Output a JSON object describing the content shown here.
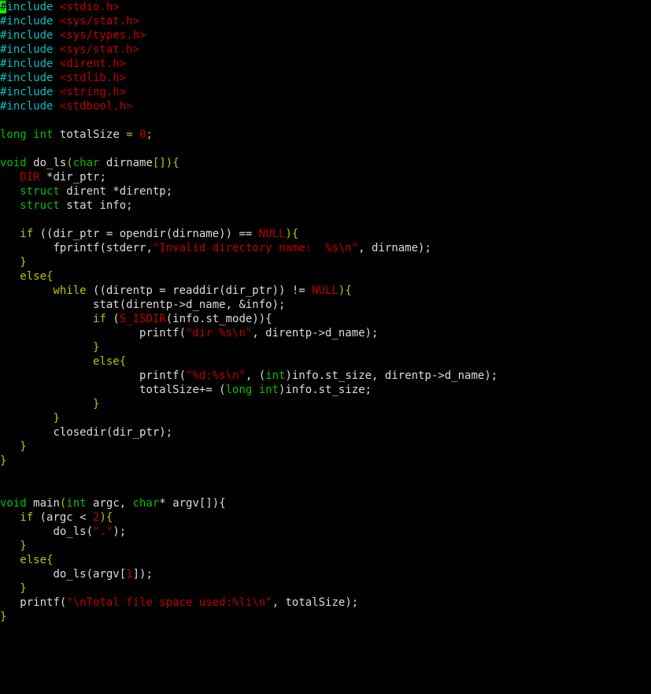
{
  "includes": [
    "<stdio.h>",
    "<sys/stat.h>",
    "<sys/types.h>",
    "<sys/stat.h>",
    "<dirent.h>",
    "<stdlib.h>",
    "<string.h>",
    "<stdbool.h>"
  ],
  "decl": {
    "type1": "long",
    "type2": "int",
    "name": "totalSize",
    "eq": "=",
    "zero": "0",
    "semi": ";"
  },
  "fn1": {
    "ret": "void",
    "name": "do_ls",
    "sig_open": "(",
    "param_type": "char",
    "param_name": "dirname",
    "param_brackets": "[]",
    "sig_close_brace": "){",
    "l1_type": "DIR",
    "l1_rest": " *dir_ptr;",
    "l2_kw": "struct",
    "l2_rest": " dirent *direntp;",
    "l3_kw": "struct",
    "l3_rest": " stat info;",
    "if_kw": "if",
    "if_expr_a": " ((dir_ptr = opendir(dirname)) == ",
    "if_null": "NULL",
    "if_expr_b": "){",
    "fprintf_a": "fprintf(stderr,",
    "fprintf_str": "\"Invalid directory name:  %s\\n\"",
    "fprintf_b": ", dirname);",
    "close1": "}",
    "else_kw": "else",
    "else_brace": "{",
    "while_kw": "while",
    "while_a": " ((direntp = readdir(dir_ptr)) != ",
    "while_null": "NULL",
    "while_b": "){",
    "stat_line": "stat(direntp->d_name, &info);",
    "if2_kw": "if",
    "if2_a": " (",
    "if2_macro": "S_ISDIR",
    "if2_b": "(info.st_mode)){",
    "printf1_a": "printf(",
    "printf1_str": "\"dir %s\\n\"",
    "printf1_b": ", direntp->d_name);",
    "close2": "}",
    "else2_kw": "else",
    "else2_brace": "{",
    "printf2_a": "printf(",
    "printf2_str": "\"%d:%s\\n\"",
    "printf2_b": ", (",
    "printf2_cast": "int",
    "printf2_c": ")info.st_size, direntp->d_name);",
    "total_a": "totalSize+= (",
    "total_cast1": "long",
    "total_sp": " ",
    "total_cast2": "int",
    "total_b": ")info.st_size;",
    "close3": "}",
    "close4": "}",
    "closedir": "closedir(dir_ptr);",
    "close5": "}",
    "close6": "}"
  },
  "fn2": {
    "ret": "void",
    "name": "main",
    "sig_a": "(",
    "p1_type": "int",
    "p1_name": " argc, ",
    "p2_type": "char",
    "p2_rest": "* argv[]){",
    "if_kw": "if",
    "if_a": " (argc < ",
    "if_num": "2",
    "if_b": "){",
    "call1_a": "do_ls(",
    "call1_str": "\".\"",
    "call1_b": ");",
    "close1": "}",
    "else_kw": "else",
    "else_brace": "{",
    "call2_a": "do_ls(argv[",
    "call2_num": "1",
    "call2_b": "]);",
    "close2": "}",
    "printf_a": "printf(",
    "printf_str": "\"\\nTotal file space used:%li\\n\"",
    "printf_b": ", totalSize);",
    "close3": "}"
  }
}
